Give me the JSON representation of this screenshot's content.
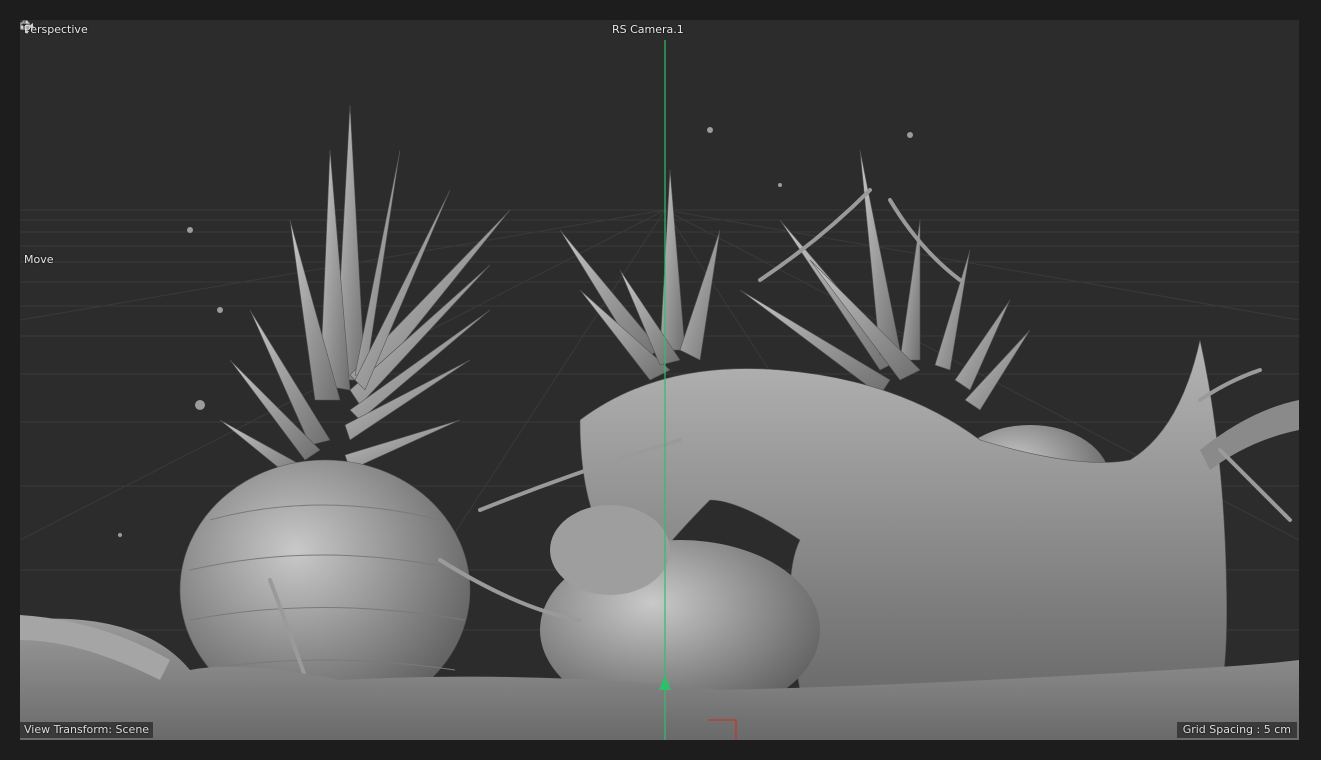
{
  "viewport": {
    "view_name": "Perspective",
    "camera_name": "RS Camera.1",
    "tool_name": "Move",
    "view_transform": "View Transform: Scene",
    "grid_spacing": "Grid Spacing : 5 cm"
  },
  "icons": {
    "camera": "camera-lock-icon",
    "move": "move-arrows-icon"
  },
  "colors": {
    "viewport_bg": "#2c2c2c",
    "frame_bg": "#1d1d1d",
    "y_axis": "#2fbf6a",
    "x_axis": "#c0392b",
    "model_shading": "#8e8e8e"
  }
}
